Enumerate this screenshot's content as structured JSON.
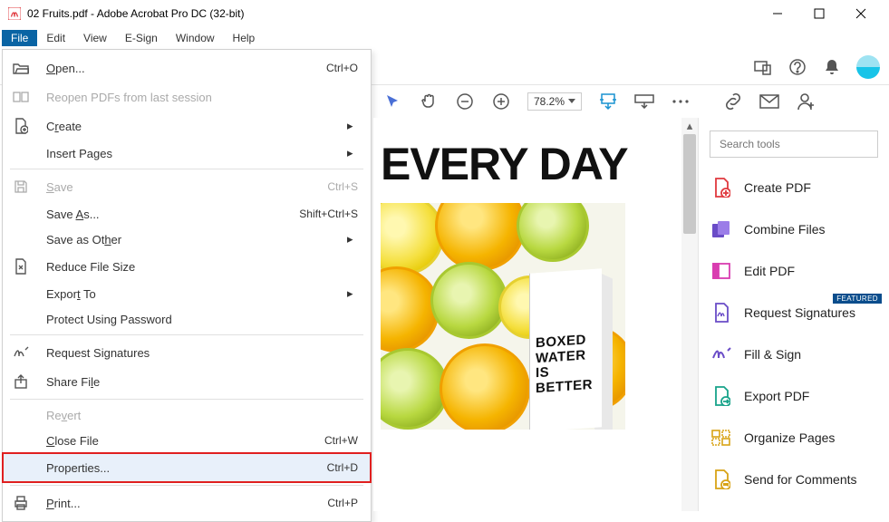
{
  "window": {
    "title": "02 Fruits.pdf - Adobe Acrobat Pro DC (32-bit)"
  },
  "menubar": {
    "items": [
      "File",
      "Edit",
      "View",
      "E-Sign",
      "Window",
      "Help"
    ],
    "active_index": 0
  },
  "file_menu": {
    "open": {
      "label": "Open...",
      "shortcut": "Ctrl+O",
      "submenu": false,
      "disabled": false
    },
    "reopen": {
      "label": "Reopen PDFs from last session",
      "shortcut": "",
      "submenu": false,
      "disabled": true
    },
    "create": {
      "label": "Create",
      "shortcut": "",
      "submenu": true,
      "disabled": false
    },
    "insert_pages": {
      "label": "Insert Pages",
      "shortcut": "",
      "submenu": true,
      "disabled": false
    },
    "save": {
      "label": "Save",
      "shortcut": "Ctrl+S",
      "submenu": false,
      "disabled": true
    },
    "save_as": {
      "label": "Save As...",
      "shortcut": "Shift+Ctrl+S",
      "submenu": false,
      "disabled": false
    },
    "save_other": {
      "label": "Save as Other",
      "shortcut": "",
      "submenu": true,
      "disabled": false
    },
    "reduce": {
      "label": "Reduce File Size",
      "shortcut": "",
      "submenu": false,
      "disabled": false
    },
    "export": {
      "label": "Export To",
      "shortcut": "",
      "submenu": true,
      "disabled": false
    },
    "protect": {
      "label": "Protect Using Password",
      "shortcut": "",
      "submenu": false,
      "disabled": false
    },
    "req_sig": {
      "label": "Request Signatures",
      "shortcut": "",
      "submenu": false,
      "disabled": false
    },
    "share": {
      "label": "Share File",
      "shortcut": "",
      "submenu": false,
      "disabled": false
    },
    "revert": {
      "label": "Revert",
      "shortcut": "",
      "submenu": false,
      "disabled": true
    },
    "close": {
      "label": "Close File",
      "shortcut": "Ctrl+W",
      "submenu": false,
      "disabled": false
    },
    "properties": {
      "label": "Properties...",
      "shortcut": "Ctrl+D",
      "submenu": false,
      "disabled": false,
      "highlight": true
    },
    "print": {
      "label": "Print...",
      "shortcut": "Ctrl+P",
      "submenu": false,
      "disabled": false
    }
  },
  "doc_toolbar": {
    "zoom": "78.2%"
  },
  "document": {
    "headline": "EVERY DAY",
    "carton_lines": [
      "BOXED",
      "WATER",
      "IS",
      "BETTER"
    ]
  },
  "tools_panel": {
    "search_placeholder": "Search tools",
    "items": [
      {
        "label": "Create PDF",
        "color": "#e0393e"
      },
      {
        "label": "Combine Files",
        "color": "#6a4cc7"
      },
      {
        "label": "Edit PDF",
        "color": "#d93db0"
      },
      {
        "label": "Request Signatures",
        "color": "#6a4cc7",
        "featured": "FEATURED"
      },
      {
        "label": "Fill & Sign",
        "color": "#6a4cc7"
      },
      {
        "label": "Export PDF",
        "color": "#17a38a"
      },
      {
        "label": "Organize Pages",
        "color": "#d8a316"
      },
      {
        "label": "Send for Comments",
        "color": "#d8a316"
      }
    ]
  }
}
